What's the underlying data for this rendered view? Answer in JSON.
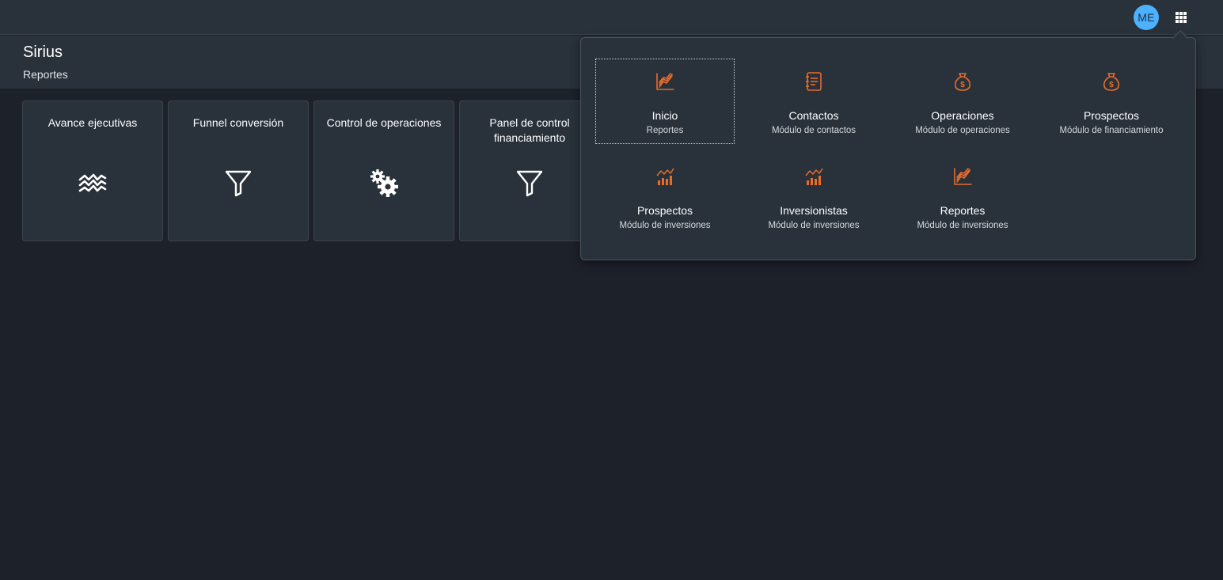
{
  "shellbar": {
    "avatar_initials": "ME",
    "avatar_color": "#4db1ff",
    "menu_icon": "grid-icon"
  },
  "header": {
    "title": "Sirius",
    "subtitle": "Reportes"
  },
  "tiles": [
    {
      "title": "Avance ejecutivas",
      "icon": "trend-waves-icon"
    },
    {
      "title": "Funnel conversión",
      "icon": "filter-icon"
    },
    {
      "title": "Control de operaciones",
      "icon": "gears-icon"
    },
    {
      "title": "Panel de control financiamiento",
      "icon": "filter-icon"
    }
  ],
  "apps": [
    {
      "title": "Inicio",
      "subtitle": "Reportes",
      "icon": "line-chart-icon"
    },
    {
      "title": "Contactos",
      "subtitle": "Módulo de contactos",
      "icon": "address-book-icon"
    },
    {
      "title": "Operaciones",
      "subtitle": "Módulo de operaciones",
      "icon": "money-bag-icon"
    },
    {
      "title": "Prospectos",
      "subtitle": "Módulo de financiamiento",
      "icon": "money-bag-icon"
    },
    {
      "title": "Prospectos",
      "subtitle": "Módulo de inversiones",
      "icon": "bar-chart-trend-icon"
    },
    {
      "title": "Inversionistas",
      "subtitle": "Módulo de inversiones",
      "icon": "bar-chart-trend-icon"
    },
    {
      "title": "Reportes",
      "subtitle": "Módulo de inversiones",
      "icon": "line-chart-icon"
    }
  ],
  "colors": {
    "accent_icon": "#e76d2b",
    "background": "#1d2129",
    "surface": "#29313a"
  }
}
